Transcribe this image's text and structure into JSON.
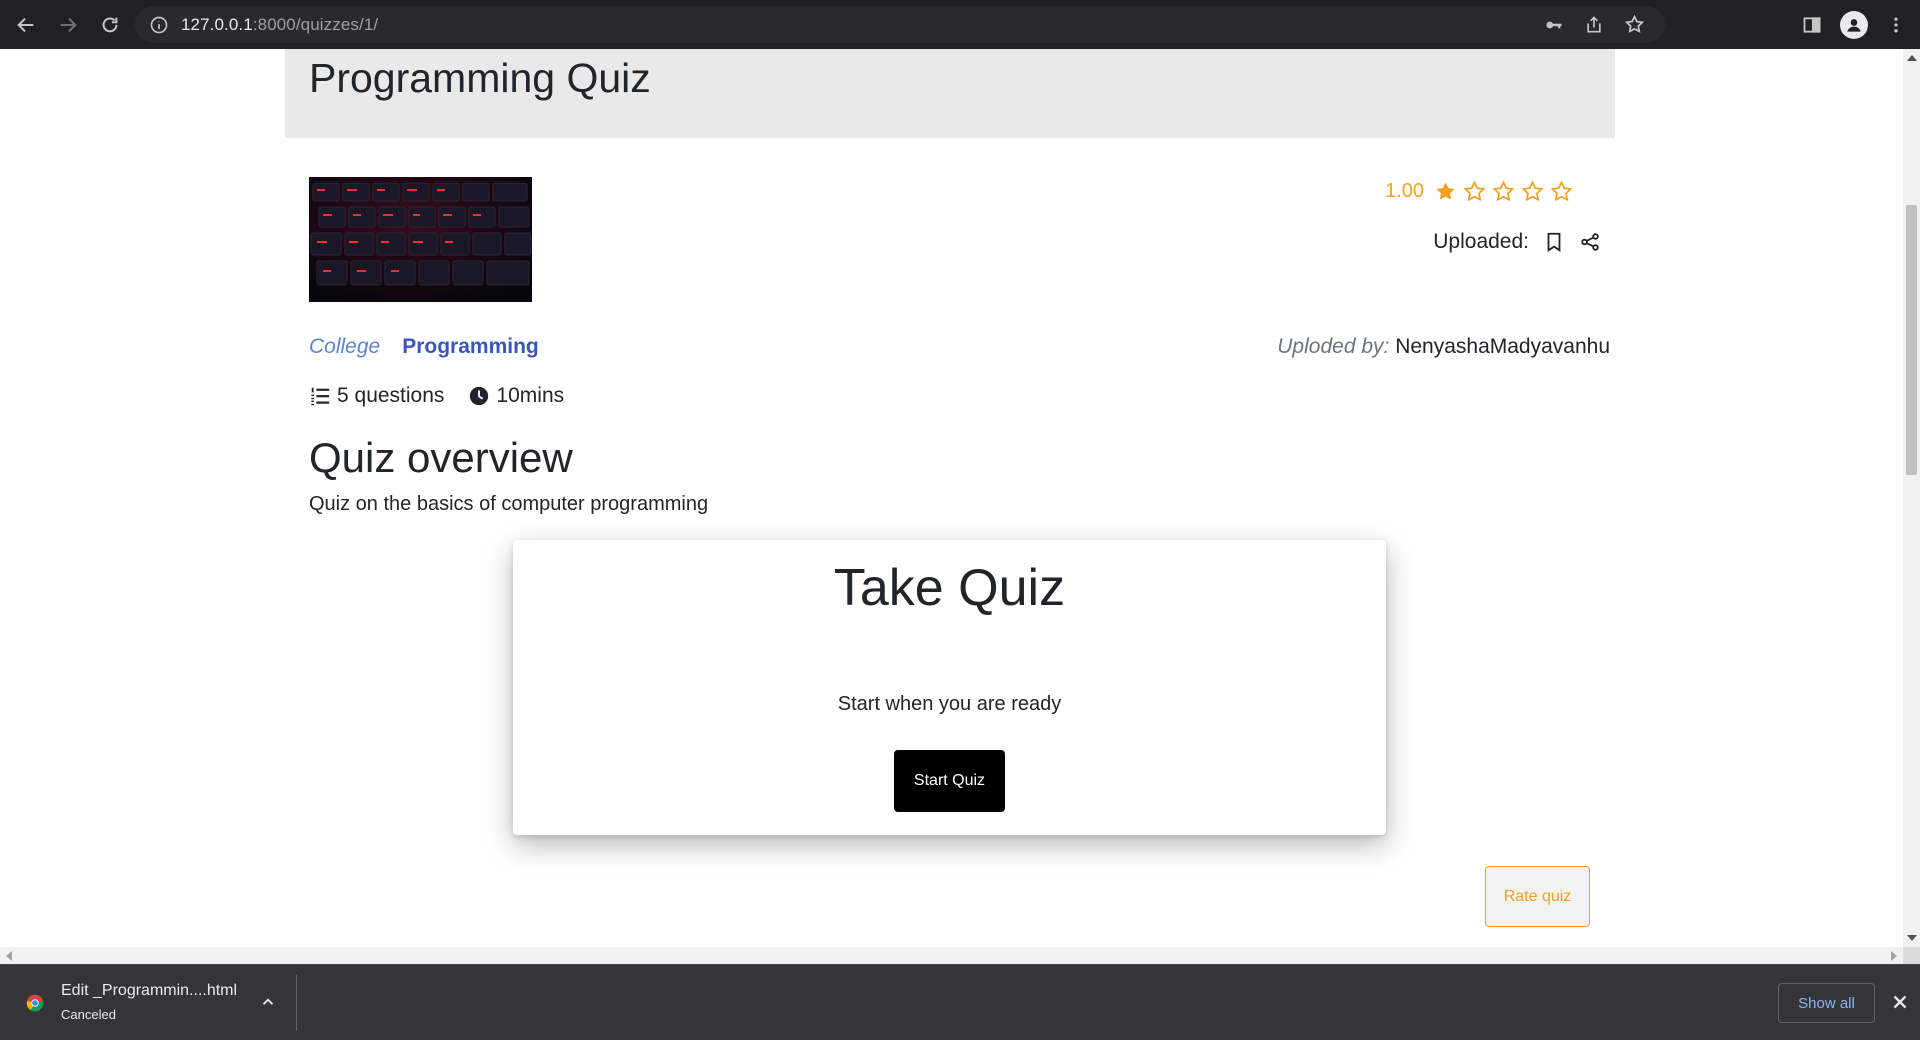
{
  "browser": {
    "url_host": "127.0.0.1",
    "url_path": ":8000/quizzes/1/"
  },
  "quiz": {
    "title": "Programming Quiz",
    "rating_value": "1.00",
    "rating_stars": 1,
    "rating_max": 5,
    "uploaded_label": "Uploaded:",
    "category_level": "College",
    "category_subject": "Programming",
    "uploaded_by_label": "Uploded by:",
    "uploader_name": "NenyashaMadyavanhu",
    "questions": "5 questions",
    "duration": "10mins",
    "overview_title": "Quiz overview",
    "overview_text": "Quiz on the basics of computer programming"
  },
  "take_card": {
    "title": "Take Quiz",
    "subtitle": "Start when you are ready",
    "start_label": "Start Quiz"
  },
  "rate_label": "Rate quiz",
  "downloads": {
    "file_name": "Edit _Programmin....html",
    "status": "Canceled",
    "show_all": "Show all"
  },
  "colors": {
    "accent_orange": "#f0a020",
    "link_blue": "#3b56b8"
  }
}
